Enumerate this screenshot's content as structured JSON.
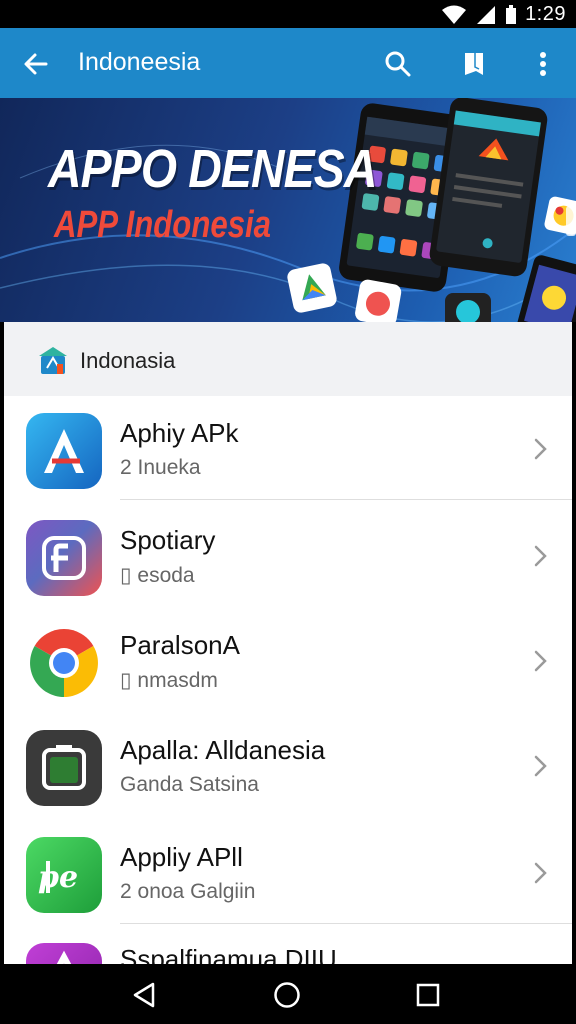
{
  "status_bar": {
    "time": "1:29"
  },
  "app_bar": {
    "title": "Indoneesia",
    "icons": [
      "back-arrow-icon",
      "search-icon",
      "bookmark-icon",
      "more-vert-icon"
    ],
    "color": "#1e88c9"
  },
  "banner": {
    "title": "APPO DENESA",
    "subtitle": "APP Indonesia",
    "subtitle_color": "#ef4a3a"
  },
  "section": {
    "label": "Indonasia",
    "icon": "store-icon"
  },
  "apps": [
    {
      "name": "Aphiy APk",
      "sub": "2 Inueka",
      "icon": "a-letter-icon"
    },
    {
      "name": "Spotiary",
      "sub": "▯ esoda",
      "icon": "f-letter-icon"
    },
    {
      "name": "ParalsonA",
      "sub": "▯ nmasdm",
      "icon": "chrome-like-icon"
    },
    {
      "name": "Apalla: Alldanesia",
      "sub": "Ganda Satsina",
      "icon": "camera-square-icon"
    },
    {
      "name": "Appliy APll",
      "sub": "2 onoa Galgiin",
      "icon": "phe-icon"
    },
    {
      "name": "Sspalfinamua DIIU",
      "sub": "",
      "icon": "purple-a-icon"
    }
  ]
}
